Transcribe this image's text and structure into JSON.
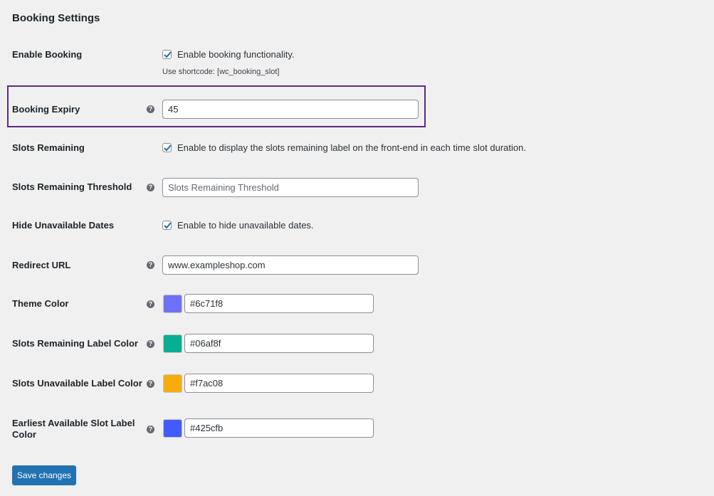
{
  "page_title": "Booking Settings",
  "fields": {
    "enable_booking": {
      "label": "Enable Booking",
      "checked": true,
      "checkbox_label": "Enable booking functionality.",
      "description": "Use shortcode: [wc_booking_slot]"
    },
    "booking_expiry": {
      "label": "Booking Expiry",
      "value": "45"
    },
    "slots_remaining": {
      "label": "Slots Remaining",
      "checked": true,
      "checkbox_label": "Enable to display the slots remaining label on the front-end in each time slot duration."
    },
    "slots_remaining_threshold": {
      "label": "Slots Remaining Threshold",
      "value": "",
      "placeholder": "Slots Remaining Threshold"
    },
    "hide_unavailable_dates": {
      "label": "Hide Unavailable Dates",
      "checked": true,
      "checkbox_label": "Enable to hide unavailable dates."
    },
    "redirect_url": {
      "label": "Redirect URL",
      "value": "www.exampleshop.com"
    },
    "theme_color": {
      "label": "Theme Color",
      "value": "#6c71f8"
    },
    "slots_remaining_label_color": {
      "label": "Slots Remaining Label Color",
      "value": "#06af8f"
    },
    "slots_unavailable_label_color": {
      "label": "Slots Unavailable Label Color",
      "value": "#f7ac08"
    },
    "earliest_available_slot_label_color": {
      "label_line1": "Earliest Available Slot Label",
      "label_line2": "Color",
      "value": "#425cfb"
    }
  },
  "help_icon": "question-circle-icon",
  "help_glyph": "?",
  "save_label": "Save changes",
  "colors": {
    "highlight_border": "#5b2b86",
    "primary_button": "#2271b1",
    "checkbox_check": "#2271b1"
  }
}
